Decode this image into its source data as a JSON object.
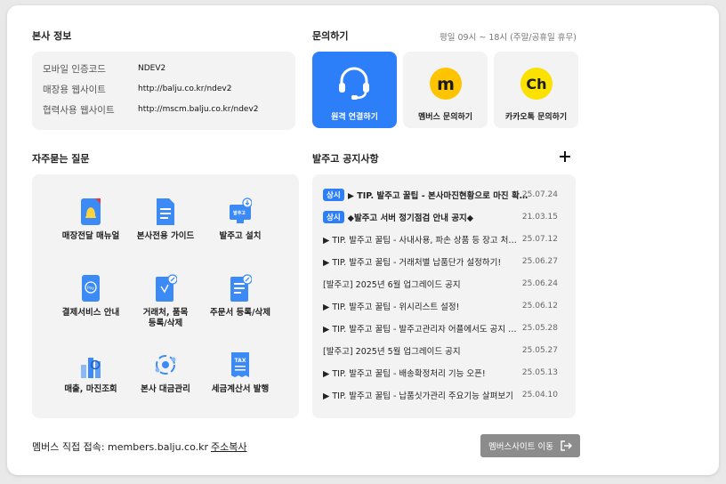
{
  "company_info": {
    "title": "본사 정보",
    "rows": [
      {
        "label": "모바일 인증코드",
        "value": "NDEV2"
      },
      {
        "label": "매장용 웹사이트",
        "value": "http://balju.co.kr/ndev2"
      },
      {
        "label": "협력사용 웹사이트",
        "value": "http://mscm.balju.co.kr/ndev2"
      }
    ]
  },
  "inquiry": {
    "title": "문의하기",
    "hours": "평일 09시 ~ 18시 (주말/공휴일 휴무)",
    "buttons": [
      {
        "label": "원격 연결하기",
        "icon": "headset-icon"
      },
      {
        "label": "멤버스 문의하기",
        "icon": "members-m-icon"
      },
      {
        "label": "카카오톡 문의하기",
        "icon": "kakaotalk-icon"
      }
    ]
  },
  "faq": {
    "title": "자주묻는 질문",
    "items": [
      {
        "label": "매장전달 매뉴얼",
        "icon": "manual-bell-icon"
      },
      {
        "label": "본사전용 가이드",
        "icon": "guide-document-icon"
      },
      {
        "label": "발주고 설치",
        "icon": "install-monitor-icon"
      },
      {
        "label": "결제서비스 안내",
        "icon": "pay-phone-icon"
      },
      {
        "label": "거래처, 품목\n등록/삭제",
        "icon": "vendor-register-icon"
      },
      {
        "label": "주문서 등록/삭제",
        "icon": "order-form-icon"
      },
      {
        "label": "매출, 마진조회",
        "icon": "sales-chart-icon"
      },
      {
        "label": "본사 대금관리",
        "icon": "payment-cycle-icon"
      },
      {
        "label": "세금계산서 발행",
        "icon": "tax-invoice-icon"
      }
    ]
  },
  "notices": {
    "title": "발주고 공지사항",
    "add_icon": "plus-icon",
    "rows": [
      {
        "badge": "상시",
        "title": "▶ TIP. 발주고 꿀팁 - 본사마진현황으로 마진 확인하기",
        "date": "25.07.24",
        "bold": true
      },
      {
        "badge": "상시",
        "title": "◆발주고 서버 정기점검 안내 공지◆",
        "date": "21.03.15",
        "bold": true
      },
      {
        "badge": "",
        "title": "▶ TIP. 발주고 꿀팁 - 사내사용, 파손 상품 등 장고 처리하기",
        "date": "25.07.12",
        "bold": false
      },
      {
        "badge": "",
        "title": "▶ TIP. 발주고 꿀팁 - 거래처별 납품단가 설정하기!",
        "date": "25.06.27",
        "bold": false
      },
      {
        "badge": "",
        "title": "[발주고] 2025년 6월 업그레이드 공지",
        "date": "25.06.24",
        "bold": false
      },
      {
        "badge": "",
        "title": "▶ TIP. 발주고 꿀팁 - 위시리스트 설정!",
        "date": "25.06.12",
        "bold": false
      },
      {
        "badge": "",
        "title": "▶ TIP. 발주고 꿀팁 - 발주고관리자 어플에서도 공지 확인하기",
        "date": "25.05.28",
        "bold": false
      },
      {
        "badge": "",
        "title": "[발주고] 2025년 5월 업그레이드 공지",
        "date": "25.05.27",
        "bold": false
      },
      {
        "badge": "",
        "title": "▶ TIP. 발주고 꿀팁 - 배송확정처리 기능 오픈!",
        "date": "25.05.13",
        "bold": false
      },
      {
        "badge": "",
        "title": "▶ TIP. 발주고 꿀팁 - 납품싯가관리 주요기능 살펴보기",
        "date": "25.04.10",
        "bold": false
      }
    ]
  },
  "footer": {
    "direct_access": "멤버스 직접 접속: members.balju.co.kr",
    "copy_link": "주소복사",
    "site_button": "멤버스사이트 이동",
    "site_button_icon": "exit-arrow-icon"
  },
  "colors": {
    "accent": "#2d7ff9",
    "kakao": "#fae100",
    "members": "#ffcc00"
  }
}
